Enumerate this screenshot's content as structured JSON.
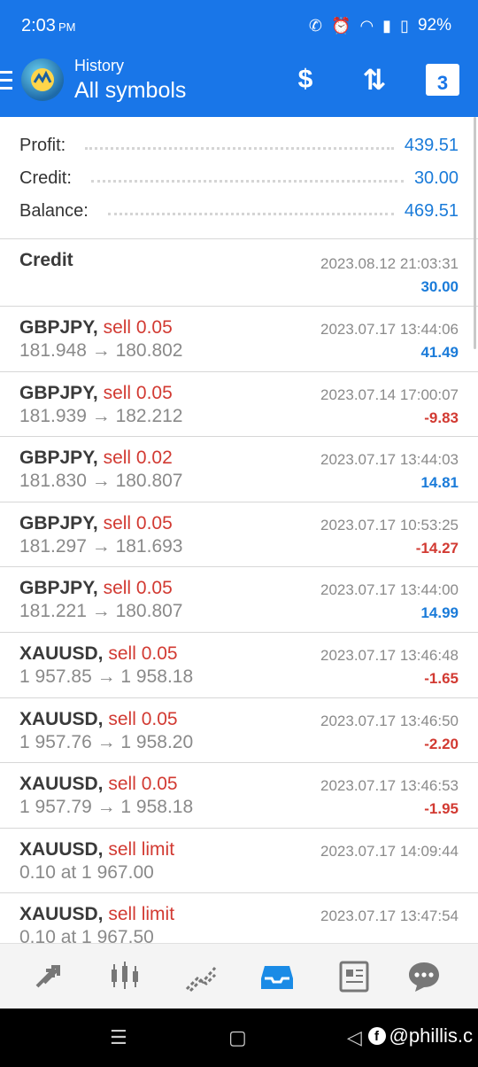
{
  "status_bar": {
    "time": "2:03",
    "ampm": "PM",
    "battery": "92%"
  },
  "header": {
    "subtitle": "History",
    "title": "All symbols",
    "calendar_day": "3"
  },
  "summary": [
    {
      "label": "Profit:",
      "value": "439.51"
    },
    {
      "label": "Credit:",
      "value": "30.00"
    },
    {
      "label": "Balance:",
      "value": "469.51"
    }
  ],
  "credit_entry": {
    "label": "Credit",
    "date": "2023.08.12 21:03:31",
    "amount": "30.00"
  },
  "deals": [
    {
      "symbol": "GBPJPY,",
      "action": "sell 0.05",
      "prices": "181.948 → 180.802",
      "date": "2023.07.17 13:44:06",
      "profit": "41.49",
      "sign": "pos"
    },
    {
      "symbol": "GBPJPY,",
      "action": "sell 0.05",
      "prices": "181.939 → 182.212",
      "date": "2023.07.14 17:00:07",
      "profit": "-9.83",
      "sign": "neg"
    },
    {
      "symbol": "GBPJPY,",
      "action": "sell 0.02",
      "prices": "181.830 → 180.807",
      "date": "2023.07.17 13:44:03",
      "profit": "14.81",
      "sign": "pos"
    },
    {
      "symbol": "GBPJPY,",
      "action": "sell 0.05",
      "prices": "181.297 → 181.693",
      "date": "2023.07.17 10:53:25",
      "profit": "-14.27",
      "sign": "neg"
    },
    {
      "symbol": "GBPJPY,",
      "action": "sell 0.05",
      "prices": "181.221 → 180.807",
      "date": "2023.07.17 13:44:00",
      "profit": "14.99",
      "sign": "pos"
    },
    {
      "symbol": "XAUUSD,",
      "action": "sell 0.05",
      "prices": "1 957.85 → 1 958.18",
      "date": "2023.07.17 13:46:48",
      "profit": "-1.65",
      "sign": "neg"
    },
    {
      "symbol": "XAUUSD,",
      "action": "sell 0.05",
      "prices": "1 957.76 → 1 958.20",
      "date": "2023.07.17 13:46:50",
      "profit": "-2.20",
      "sign": "neg"
    },
    {
      "symbol": "XAUUSD,",
      "action": "sell 0.05",
      "prices": "1 957.79 → 1 958.18",
      "date": "2023.07.17 13:46:53",
      "profit": "-1.95",
      "sign": "neg"
    },
    {
      "symbol": "XAUUSD,",
      "action": "sell limit",
      "prices": "0.10 at 1 967.00",
      "date": "2023.07.17 14:09:44",
      "profit": "",
      "sign": "pos"
    },
    {
      "symbol": "XAUUSD,",
      "action": "sell limit",
      "prices": "0.10 at 1 967.50",
      "date": "2023.07.17 13:47:54",
      "profit": "",
      "sign": "pos"
    }
  ],
  "bottom_nav": [
    {
      "name": "quotes",
      "icon": "arrows-icon",
      "active": false
    },
    {
      "name": "chart",
      "icon": "candles-icon",
      "active": false
    },
    {
      "name": "trade",
      "icon": "trend-icon",
      "active": false
    },
    {
      "name": "history",
      "icon": "inbox-icon",
      "active": true
    },
    {
      "name": "news",
      "icon": "news-icon",
      "active": false
    },
    {
      "name": "chat",
      "icon": "chat-icon",
      "active": false
    }
  ],
  "watermark": "@phillis.c",
  "colors": {
    "primary": "#1976e8",
    "positive": "#1a7bd9",
    "negative": "#d23a32"
  }
}
